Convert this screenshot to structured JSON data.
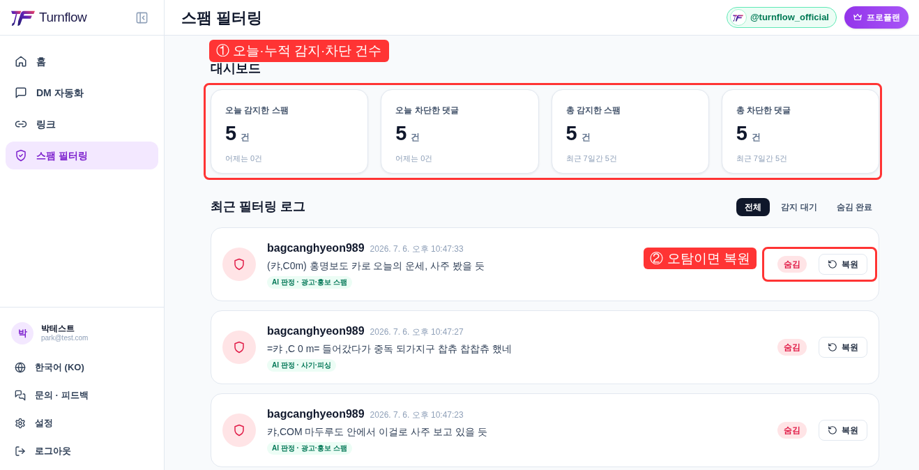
{
  "sidebar": {
    "brand": "Turnflow",
    "nav": [
      {
        "label": "홈",
        "selected": false
      },
      {
        "label": "DM 자동화",
        "selected": false
      },
      {
        "label": "링크",
        "selected": false
      },
      {
        "label": "스팸 필터링",
        "selected": true
      }
    ],
    "user": {
      "avatar": "박",
      "name": "박테스트",
      "email": "park@test.com"
    },
    "footer_items": [
      {
        "label": "한국어 (KO)"
      },
      {
        "label": "문의 · 피드백"
      },
      {
        "label": "설정"
      },
      {
        "label": "로그아웃"
      }
    ]
  },
  "header": {
    "title": "스팸 필터링",
    "account": "@turnflow_official",
    "plan_button": "프로플랜"
  },
  "dashboard": {
    "callout": "① 오늘·누적 감지·차단 건수",
    "title": "대시보드",
    "cards": [
      {
        "label": "오늘 감지한 스팸",
        "value": "5",
        "unit": "건",
        "note": "어제는 0건"
      },
      {
        "label": "오늘 차단한 댓글",
        "value": "5",
        "unit": "건",
        "note": "어제는 0건"
      },
      {
        "label": "총 감지한 스팸",
        "value": "5",
        "unit": "건",
        "note": "최근 7일간 5건"
      },
      {
        "label": "총 차단한 댓글",
        "value": "5",
        "unit": "건",
        "note": "최근 7일간 5건"
      }
    ]
  },
  "log": {
    "title": "최근 필터링 로그",
    "filters": [
      {
        "label": "전체",
        "selected": true
      },
      {
        "label": "감지 대기",
        "selected": false
      },
      {
        "label": "숨김 완료",
        "selected": false
      }
    ],
    "items": [
      {
        "user": "bagcanghyeon989",
        "time": "2026. 7. 6. 오후 10:47:33",
        "text": "(캬,C0m) 홍명보도 카로 오늘의 운세, 사주 봤을 듯",
        "tag": "AI 판정 · 광고·홍보 스팸",
        "status": "숨김",
        "action": "복원",
        "callout": "② 오탐이면 복원"
      },
      {
        "user": "bagcanghyeon989",
        "time": "2026. 7. 6. 오후 10:47:27",
        "text": "=캬 ,C 0 m= 들어갔다가 중독 되가지구 찹츄 찹찹츄 했네",
        "tag": "AI 판정 · 사기·피싱",
        "status": "숨김",
        "action": "복원"
      },
      {
        "user": "bagcanghyeon989",
        "time": "2026. 7. 6. 오후 10:47:23",
        "text": "캬,COM 마두루도 안에서 이걸로 사주 보고 있을 듯",
        "tag": "AI 판정 · 광고·홍보 스팸",
        "status": "숨김",
        "action": "복원"
      }
    ]
  }
}
